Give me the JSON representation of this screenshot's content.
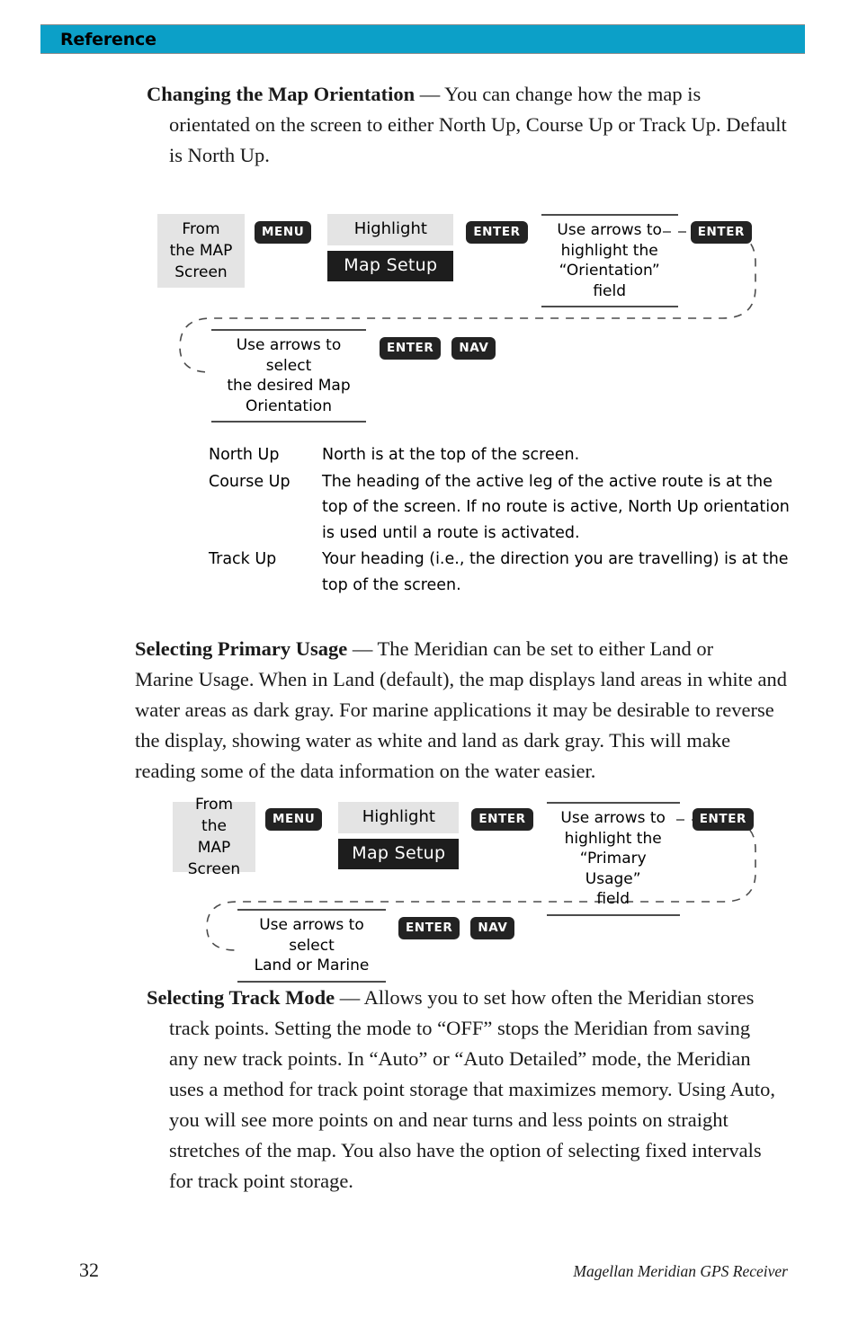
{
  "header": {
    "title": "Reference",
    "band_color": "#0ca0c8"
  },
  "sections": {
    "map_orientation": {
      "heading": "Changing the Map Orientation",
      "dash": " — ",
      "line1": "You can change how the map is",
      "body": "orientated on the screen to either North Up, Course Up or Track Up. Default is North Up."
    },
    "primary_usage": {
      "heading": "Selecting Primary Usage",
      "dash": " — ",
      "line1": "The Meridian can be set to either Land or",
      "body": "Marine Usage.  When in Land (default), the map displays land areas in white and water areas as dark gray.  For marine applications it may be desirable to reverse the display, showing water as white and land as dark gray.  This will make reading some of the data information on the water easier."
    },
    "track_mode": {
      "heading": "Selecting Track Mode",
      "dash": " — ",
      "line1": "Allows you to set how often the Meridian stores",
      "body": "track points.  Setting the mode to “OFF” stops the Meridian from saving any new track points.  In “Auto” or “Auto Detailed” mode, the Meridian uses a method for track point storage that maximizes memory.  Using Auto, you will see more points on and near turns and less points on straight stretches of the map.  You also have the option of selecting fixed intervals for track point storage."
    }
  },
  "orientation_options": {
    "rows": [
      {
        "term": "North Up",
        "desc": "North is at the top of the screen."
      },
      {
        "term": "Course Up",
        "desc": "The heading of the active leg of the active route is at the top of the screen.  If no route is active, North Up orientation is used until a route is activated."
      },
      {
        "term": "Track Up",
        "desc": "Your heading (i.e., the direction you are travelling) is at the top of the screen."
      }
    ]
  },
  "diagram_orientation": {
    "start_block": "From\nthe MAP\nScreen",
    "key_menu": "MENU",
    "highlight_label": "Highlight",
    "highlight_item": "Map Setup",
    "key_enter_1": "ENTER",
    "instruction_1": "Use arrows to\nhighlight the\n“Orientation” field",
    "key_enter_2": "ENTER",
    "instruction_2": "Use arrows to select\nthe desired Map\nOrientation",
    "key_enter_3": "ENTER",
    "key_nav": "NAV"
  },
  "diagram_usage": {
    "start_block": "From\nthe MAP\nScreen",
    "key_menu": "MENU",
    "highlight_label": "Highlight",
    "highlight_item": "Map Setup",
    "key_enter_1": "ENTER",
    "instruction_1": "Use arrows to\nhighlight the\n“Primary Usage”\nfield",
    "key_enter_2": "ENTER",
    "instruction_2": "Use arrows to select\nLand or Marine",
    "key_enter_3": "ENTER",
    "key_nav": "NAV"
  },
  "footer": {
    "page_number": "32",
    "product_note": "Magellan Meridian GPS Receiver"
  }
}
